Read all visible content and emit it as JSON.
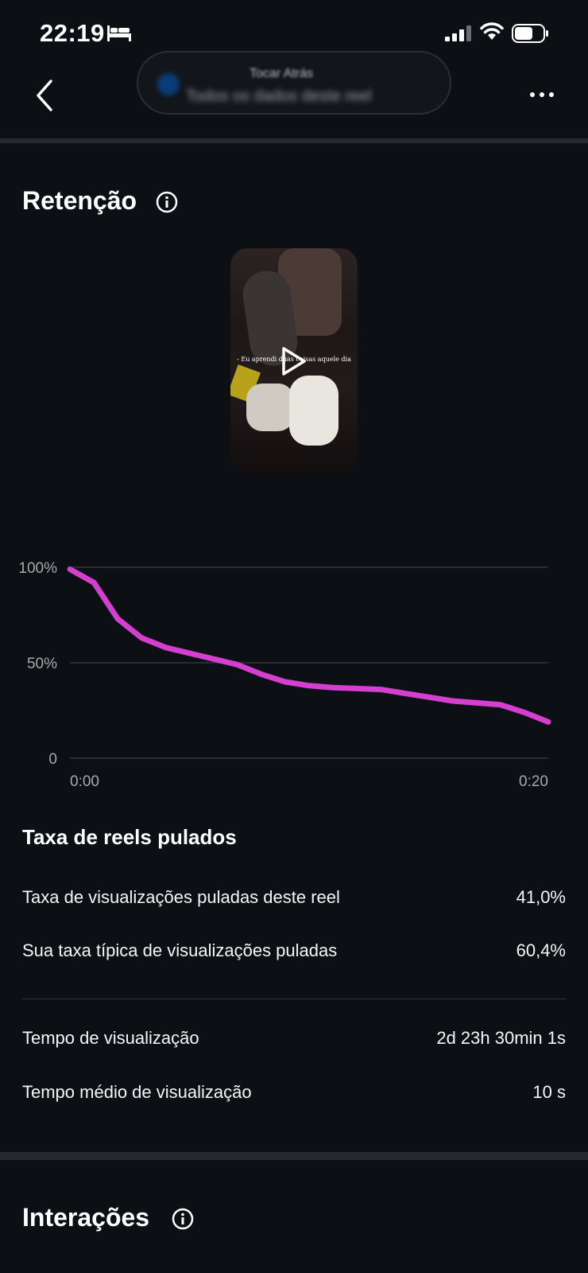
{
  "status_bar": {
    "time": "22:19"
  },
  "nav": {
    "pill_line1": "Tocar Atrás",
    "pill_line2": "Todos os dados deste reel"
  },
  "retention": {
    "title": "Retenção",
    "video_caption": "- Eu aprendi duas coisas aquele dia"
  },
  "chart_data": {
    "type": "line",
    "y_tick_labels": [
      "100%",
      "50%",
      "0"
    ],
    "x_tick_labels": [
      "0:00",
      "0:20"
    ],
    "ylim": [
      0,
      100
    ],
    "xlim": [
      0,
      20
    ],
    "grid": true,
    "color": "#d53fd0",
    "series": [
      {
        "x": [
          0,
          1,
          2,
          3,
          4,
          5,
          6,
          7,
          8,
          9,
          10,
          11,
          12,
          13,
          14,
          15,
          16,
          17,
          18,
          19,
          20
        ],
        "y": [
          99,
          92,
          73,
          63,
          58,
          55,
          52,
          49,
          44,
          40,
          38,
          37,
          36.5,
          36,
          34,
          32,
          30,
          29,
          28,
          24,
          19
        ]
      }
    ]
  },
  "skip_rate": {
    "title": "Taxa de reels pulados",
    "rows": [
      {
        "label": "Taxa de visualizações puladas deste reel",
        "value": "41,0%"
      },
      {
        "label": "Sua taxa típica de visualizações puladas",
        "value": "60,4%"
      }
    ]
  },
  "watch_time": {
    "rows": [
      {
        "label": "Tempo de visualização",
        "value": "2d 23h 30min 1s"
      },
      {
        "label": "Tempo médio de visualização",
        "value": "10 s"
      }
    ]
  },
  "interactions": {
    "title": "Interações"
  }
}
